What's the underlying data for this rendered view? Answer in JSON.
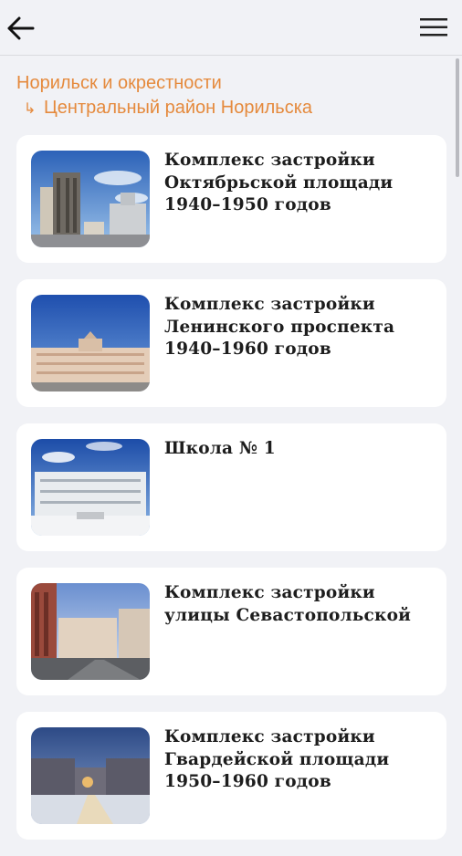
{
  "header": {
    "back_icon": "arrow-left-icon",
    "menu_icon": "hamburger-menu-icon"
  },
  "breadcrumb": {
    "parent": "Норильск и окрестности",
    "current": "Центральный район Норильска",
    "accent_color": "#e58a3d"
  },
  "items": [
    {
      "title": "Комплекс застройки\nОктябрьской площади\n1940–1950 годов"
    },
    {
      "title": "Комплекс застройки\nЛенинского проспекта\n1940–1960 годов"
    },
    {
      "title": "Школа № 1"
    },
    {
      "title": "Комплекс застройки\nулицы Севастопольской"
    },
    {
      "title": "Комплекс застройки\nГвардейской площади\n1950–1960 годов"
    }
  ]
}
